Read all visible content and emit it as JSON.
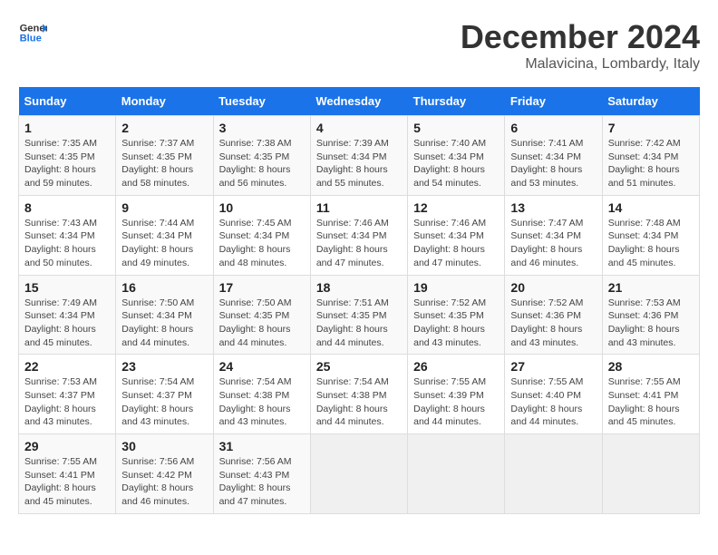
{
  "logo": {
    "line1": "General",
    "line2": "Blue"
  },
  "title": "December 2024",
  "location": "Malavicina, Lombardy, Italy",
  "weekdays": [
    "Sunday",
    "Monday",
    "Tuesday",
    "Wednesday",
    "Thursday",
    "Friday",
    "Saturday"
  ],
  "weeks": [
    [
      {
        "day": "1",
        "info": "Sunrise: 7:35 AM\nSunset: 4:35 PM\nDaylight: 8 hours\nand 59 minutes."
      },
      {
        "day": "2",
        "info": "Sunrise: 7:37 AM\nSunset: 4:35 PM\nDaylight: 8 hours\nand 58 minutes."
      },
      {
        "day": "3",
        "info": "Sunrise: 7:38 AM\nSunset: 4:35 PM\nDaylight: 8 hours\nand 56 minutes."
      },
      {
        "day": "4",
        "info": "Sunrise: 7:39 AM\nSunset: 4:34 PM\nDaylight: 8 hours\nand 55 minutes."
      },
      {
        "day": "5",
        "info": "Sunrise: 7:40 AM\nSunset: 4:34 PM\nDaylight: 8 hours\nand 54 minutes."
      },
      {
        "day": "6",
        "info": "Sunrise: 7:41 AM\nSunset: 4:34 PM\nDaylight: 8 hours\nand 53 minutes."
      },
      {
        "day": "7",
        "info": "Sunrise: 7:42 AM\nSunset: 4:34 PM\nDaylight: 8 hours\nand 51 minutes."
      }
    ],
    [
      {
        "day": "8",
        "info": "Sunrise: 7:43 AM\nSunset: 4:34 PM\nDaylight: 8 hours\nand 50 minutes."
      },
      {
        "day": "9",
        "info": "Sunrise: 7:44 AM\nSunset: 4:34 PM\nDaylight: 8 hours\nand 49 minutes."
      },
      {
        "day": "10",
        "info": "Sunrise: 7:45 AM\nSunset: 4:34 PM\nDaylight: 8 hours\nand 48 minutes."
      },
      {
        "day": "11",
        "info": "Sunrise: 7:46 AM\nSunset: 4:34 PM\nDaylight: 8 hours\nand 47 minutes."
      },
      {
        "day": "12",
        "info": "Sunrise: 7:46 AM\nSunset: 4:34 PM\nDaylight: 8 hours\nand 47 minutes."
      },
      {
        "day": "13",
        "info": "Sunrise: 7:47 AM\nSunset: 4:34 PM\nDaylight: 8 hours\nand 46 minutes."
      },
      {
        "day": "14",
        "info": "Sunrise: 7:48 AM\nSunset: 4:34 PM\nDaylight: 8 hours\nand 45 minutes."
      }
    ],
    [
      {
        "day": "15",
        "info": "Sunrise: 7:49 AM\nSunset: 4:34 PM\nDaylight: 8 hours\nand 45 minutes."
      },
      {
        "day": "16",
        "info": "Sunrise: 7:50 AM\nSunset: 4:34 PM\nDaylight: 8 hours\nand 44 minutes."
      },
      {
        "day": "17",
        "info": "Sunrise: 7:50 AM\nSunset: 4:35 PM\nDaylight: 8 hours\nand 44 minutes."
      },
      {
        "day": "18",
        "info": "Sunrise: 7:51 AM\nSunset: 4:35 PM\nDaylight: 8 hours\nand 44 minutes."
      },
      {
        "day": "19",
        "info": "Sunrise: 7:52 AM\nSunset: 4:35 PM\nDaylight: 8 hours\nand 43 minutes."
      },
      {
        "day": "20",
        "info": "Sunrise: 7:52 AM\nSunset: 4:36 PM\nDaylight: 8 hours\nand 43 minutes."
      },
      {
        "day": "21",
        "info": "Sunrise: 7:53 AM\nSunset: 4:36 PM\nDaylight: 8 hours\nand 43 minutes."
      }
    ],
    [
      {
        "day": "22",
        "info": "Sunrise: 7:53 AM\nSunset: 4:37 PM\nDaylight: 8 hours\nand 43 minutes."
      },
      {
        "day": "23",
        "info": "Sunrise: 7:54 AM\nSunset: 4:37 PM\nDaylight: 8 hours\nand 43 minutes."
      },
      {
        "day": "24",
        "info": "Sunrise: 7:54 AM\nSunset: 4:38 PM\nDaylight: 8 hours\nand 43 minutes."
      },
      {
        "day": "25",
        "info": "Sunrise: 7:54 AM\nSunset: 4:38 PM\nDaylight: 8 hours\nand 44 minutes."
      },
      {
        "day": "26",
        "info": "Sunrise: 7:55 AM\nSunset: 4:39 PM\nDaylight: 8 hours\nand 44 minutes."
      },
      {
        "day": "27",
        "info": "Sunrise: 7:55 AM\nSunset: 4:40 PM\nDaylight: 8 hours\nand 44 minutes."
      },
      {
        "day": "28",
        "info": "Sunrise: 7:55 AM\nSunset: 4:41 PM\nDaylight: 8 hours\nand 45 minutes."
      }
    ],
    [
      {
        "day": "29",
        "info": "Sunrise: 7:55 AM\nSunset: 4:41 PM\nDaylight: 8 hours\nand 45 minutes."
      },
      {
        "day": "30",
        "info": "Sunrise: 7:56 AM\nSunset: 4:42 PM\nDaylight: 8 hours\nand 46 minutes."
      },
      {
        "day": "31",
        "info": "Sunrise: 7:56 AM\nSunset: 4:43 PM\nDaylight: 8 hours\nand 47 minutes."
      },
      {
        "day": "",
        "info": ""
      },
      {
        "day": "",
        "info": ""
      },
      {
        "day": "",
        "info": ""
      },
      {
        "day": "",
        "info": ""
      }
    ]
  ]
}
